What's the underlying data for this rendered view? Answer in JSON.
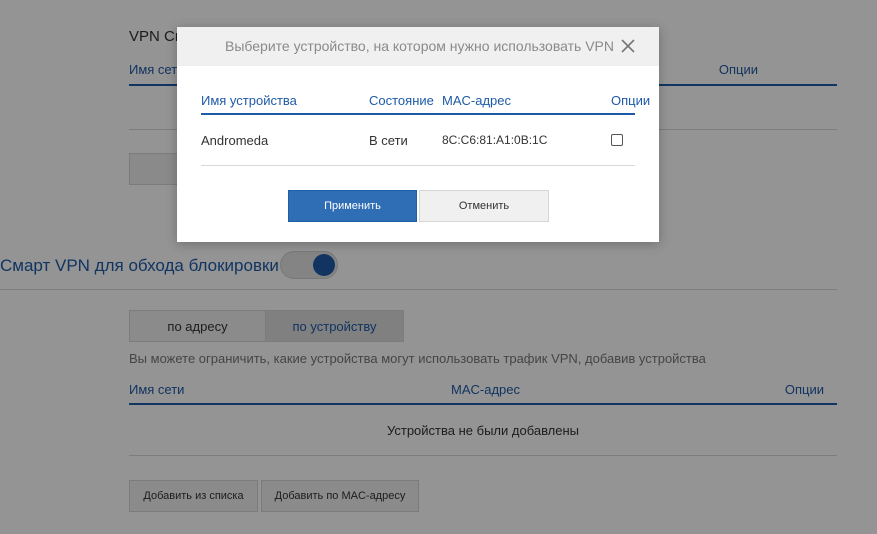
{
  "background": {
    "vpn_list_title": "VPN Сп",
    "list_header": {
      "name": "Имя сети",
      "options": "Опции"
    },
    "smart_vpn_title": "Смарт VPN для обхода блокировки",
    "toggle_on": true,
    "tabs": [
      {
        "label": "по адресу",
        "active": false
      },
      {
        "label": "по устройству",
        "active": true
      }
    ],
    "hint": "Вы можете ограничить, какие устройства могут использовать трафик VPN, добавив устройства",
    "table_header": {
      "name": "Имя сети",
      "mac": "MAC-адрес",
      "options": "Опции"
    },
    "empty_text": "Устройства не были добавлены",
    "buttons": {
      "add_from_list": "Добавить из списка",
      "add_by_mac": "Добавить по MAC-адресу"
    }
  },
  "modal": {
    "title": "Выберите устройство, на котором нужно использовать VPN",
    "columns": {
      "device": "Имя устройства",
      "state": "Состояние",
      "mac": "MAC-адрес",
      "options": "Опции"
    },
    "rows": [
      {
        "device": "Andromeda",
        "state": "В сети",
        "mac": "8C:C6:81:A1:0B:1C",
        "checked": false
      }
    ],
    "apply_label": "Применить",
    "cancel_label": "Отменить"
  },
  "colors": {
    "accent": "#1e5aa8",
    "primary_button": "#2f6db5"
  },
  "icons": {
    "close": "close-icon",
    "checkbox": "checkbox"
  }
}
